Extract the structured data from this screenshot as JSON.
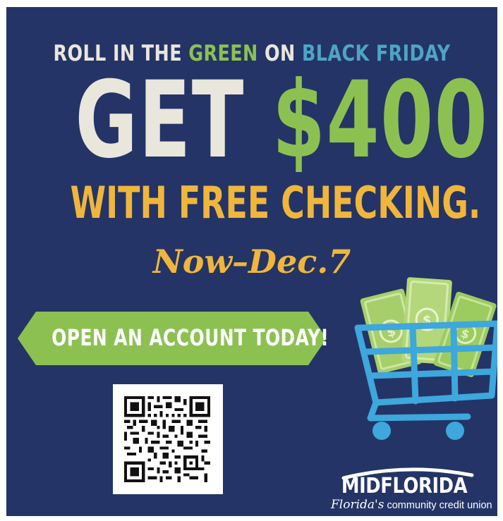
{
  "ad": {
    "headline_top": {
      "part1": "ROLL IN THE ",
      "part2": "GREEN",
      "part3": " ON ",
      "part4": "BLACK FRIDAY"
    },
    "headline_main": {
      "word": "GET ",
      "amount": "$400"
    },
    "headline_sub": "WITH FREE CHECKING.",
    "dates": "Now–Dec.7",
    "cta_banner": "OPEN AN ACCOUNT TODAY!",
    "qr_code": "qr-code",
    "illustration": "shopping-cart-with-money"
  },
  "logo": {
    "name": "MIDFLORIDA",
    "tagline_script": "Florida's",
    "tagline_rest": " community credit union"
  },
  "colors": {
    "background": "#243466",
    "cream": "#e9e6dc",
    "green": "#8cc152",
    "teal": "#4fa4c6",
    "gold": "#f0b63c",
    "cart_blue": "#3ea7dc"
  }
}
